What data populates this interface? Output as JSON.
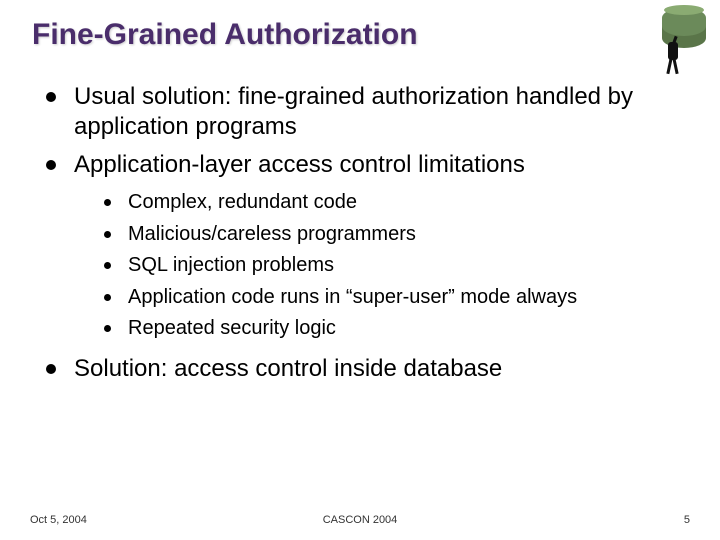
{
  "title": "Fine-Grained Authorization",
  "bullets": {
    "b0": "Usual solution: fine-grained authorization handled by application programs",
    "b1": "Application-layer access control limitations",
    "b2": "Solution: access control inside database"
  },
  "sub": {
    "s0": "Complex, redundant code",
    "s1": "Malicious/careless programmers",
    "s2": "SQL injection problems",
    "s3": "Application code runs in “super-user” mode always",
    "s4": "Repeated security logic"
  },
  "footer": {
    "date": "Oct 5, 2004",
    "conference": "CASCON 2004",
    "page": "5"
  }
}
